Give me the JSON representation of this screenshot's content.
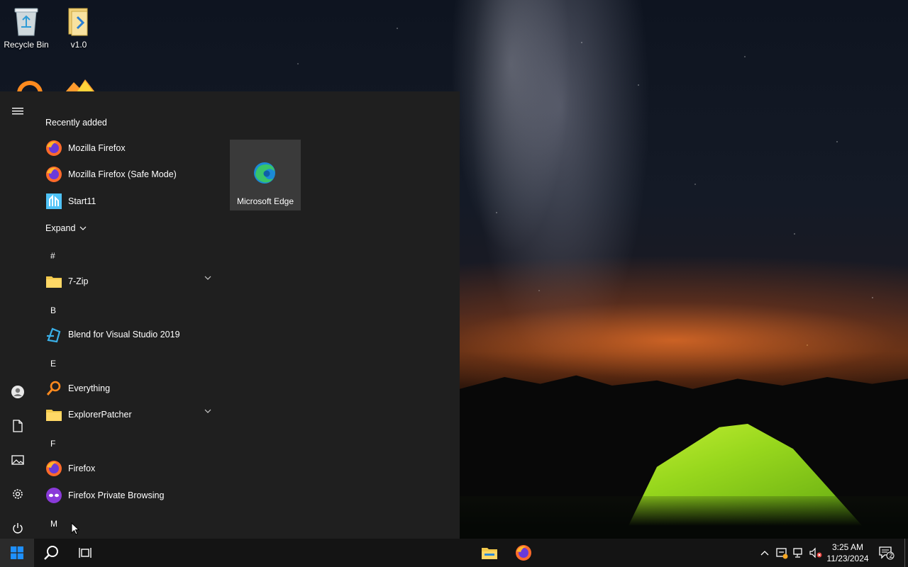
{
  "desktop": {
    "icons": [
      {
        "label": "Recycle Bin",
        "icon": "recycle-bin-icon"
      },
      {
        "label": "v1.0",
        "icon": "folder-shortcut-icon"
      }
    ],
    "partial_icons": [
      "everything-icon",
      "firefox-folder-icon"
    ]
  },
  "start_menu": {
    "rail": [
      "hamburger-icon",
      "user-icon",
      "documents-icon",
      "pictures-icon",
      "settings-icon",
      "power-icon"
    ],
    "recently_added_header": "Recently added",
    "recent_apps": [
      {
        "label": "Mozilla Firefox",
        "icon": "firefox-icon"
      },
      {
        "label": "Mozilla Firefox (Safe Mode)",
        "icon": "firefox-icon"
      },
      {
        "label": "Start11",
        "icon": "start11-icon"
      }
    ],
    "expand_label": "Expand",
    "letters": {
      "hash": "#",
      "b": "B",
      "e": "E",
      "f": "F",
      "m": "M"
    },
    "apps": {
      "seven_zip": {
        "label": "7-Zip",
        "icon": "folder-icon",
        "has_children": true
      },
      "blend": {
        "label": "Blend for Visual Studio 2019",
        "icon": "blend-icon"
      },
      "everything": {
        "label": "Everything",
        "icon": "everything-icon"
      },
      "explorerpatcher": {
        "label": "ExplorerPatcher",
        "icon": "folder-icon",
        "has_children": true
      },
      "firefox": {
        "label": "Firefox",
        "icon": "firefox-icon"
      },
      "firefox_private": {
        "label": "Firefox Private Browsing",
        "icon": "firefox-private-icon"
      }
    },
    "tiles": [
      {
        "label": "Microsoft Edge",
        "icon": "edge-icon"
      }
    ]
  },
  "taskbar": {
    "pinned": [
      "file-explorer-icon",
      "firefox-icon"
    ],
    "tray": [
      "chevron-up-icon",
      "security-icon",
      "network-icon",
      "volume-muted-icon"
    ],
    "clock": {
      "time": "3:25 AM",
      "date": "11/23/2024"
    },
    "notifications_count": "2"
  },
  "colors": {
    "menu_bg": "#1f1f1f",
    "tile_bg": "#3a3a3a",
    "taskbar_bg": "#141414",
    "folder_yellow": "#f2c94c",
    "start_blue": "#1e90ff"
  }
}
